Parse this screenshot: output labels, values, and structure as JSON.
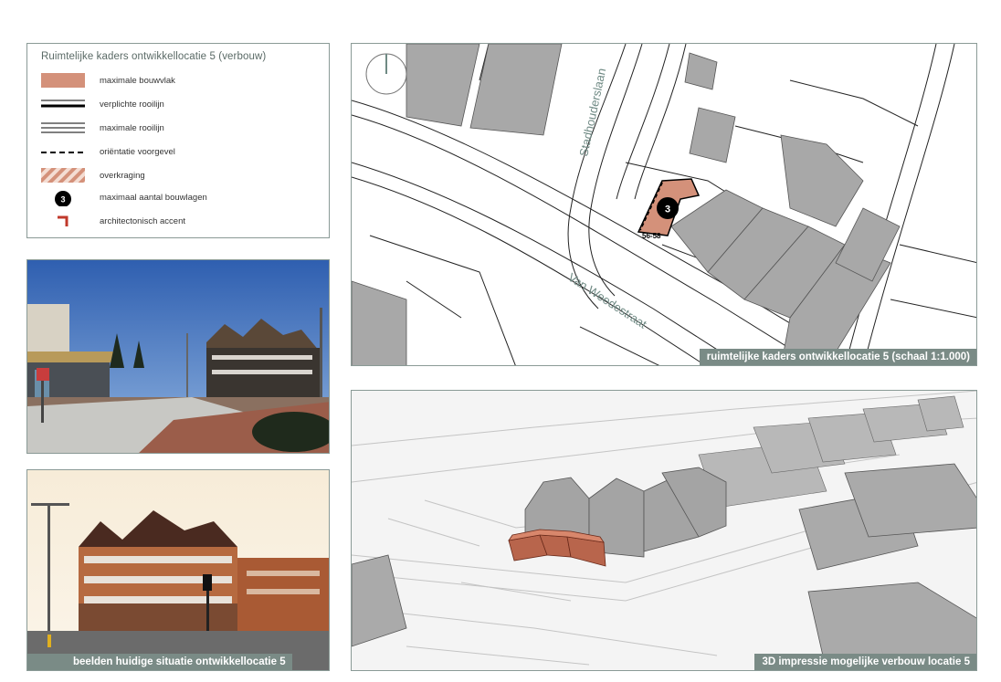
{
  "legend": {
    "title": "Ruimtelijke kaders ontwikkellocatie 5 (verbouw)",
    "items": [
      {
        "symbol": "salmon-fill",
        "label": "maximale bouwvlak"
      },
      {
        "symbol": "thick-line",
        "label": "verplichte rooilijn"
      },
      {
        "symbol": "double-line",
        "label": "maximale rooilijn"
      },
      {
        "symbol": "dashed-line",
        "label": "oriëntatie voorgevel"
      },
      {
        "symbol": "hatched-fill",
        "label": "overkraging"
      },
      {
        "symbol": "black-circle",
        "label": "maximaal aantal bouwlagen",
        "badge": "3"
      },
      {
        "symbol": "red-corner",
        "label": "architectonisch accent"
      }
    ]
  },
  "map": {
    "caption": "ruimtelijke kaders ontwikkellocatie 5 (schaal 1:1.000)",
    "streets": {
      "north_south": "Stadhouderslaan",
      "east_west": "Van Weedestraat"
    },
    "house_numbers": "56-58",
    "floors_badge": "3"
  },
  "photos": {
    "photo1_caption": "",
    "photo2_caption": "beelden huidige situatie ontwikkellocatie 5"
  },
  "view3d": {
    "caption": "3D impressie mogelijke verbouw locatie 5"
  },
  "colors": {
    "accent_salmon": "#d4917a",
    "building_gray": "#a8a8a8",
    "caption_bg": "#7a8b86",
    "accent_red": "#c0392b",
    "street_label": "#6f8a84"
  }
}
